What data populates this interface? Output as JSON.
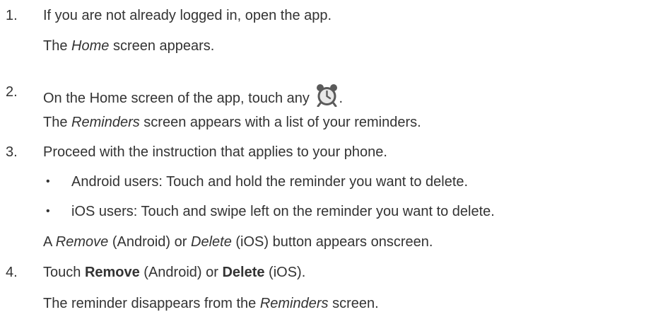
{
  "steps": [
    {
      "number": "1.",
      "text": "If you are not already logged in, open the app.",
      "result": {
        "pre": "The ",
        "em": "Home",
        "post": " screen appears."
      }
    },
    {
      "number": "2.",
      "text_pre": "On the Home screen of the app, touch any ",
      "icon": "alarm-clock-icon",
      "text_post": ".",
      "result": {
        "pre": "The ",
        "em": "Reminders",
        "post": " screen appears with a list of your reminders."
      }
    },
    {
      "number": "3.",
      "text": "Proceed with the instruction that applies to your phone.",
      "bullets": [
        {
          "symbol": "•",
          "text": "Android users: Touch and hold the reminder you want to delete."
        },
        {
          "symbol": "•",
          "text": "iOS users: Touch and swipe left on the reminder you want to delete."
        }
      ],
      "result": {
        "pre": "A ",
        "em1": "Remove",
        "mid": " (Android) or ",
        "em2": "Delete",
        "post": " (iOS) button appears onscreen."
      }
    },
    {
      "number": "4.",
      "text_pre": "Touch ",
      "strong1": "Remove",
      "text_mid": " (Android) or ",
      "strong2": "Delete",
      "text_post": " (iOS).",
      "result": {
        "pre": "The reminder disappears from the ",
        "em": "Reminders",
        "post": " screen."
      }
    }
  ],
  "colors": {
    "text": "#333333",
    "icon_ring": "#5a5a5a",
    "icon_face": "#e8e8e8"
  }
}
